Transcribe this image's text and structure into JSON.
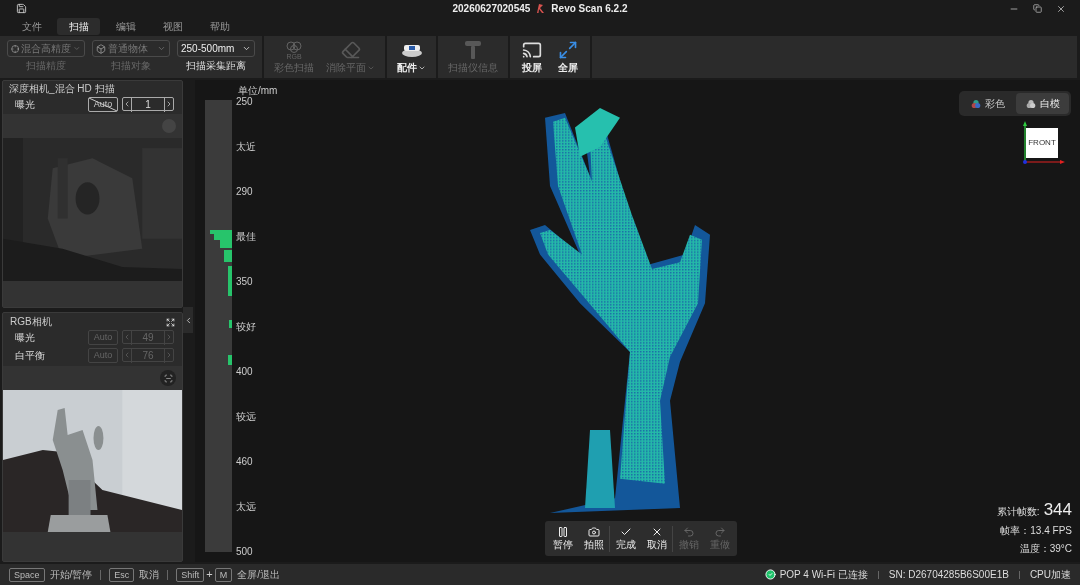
{
  "title_bar": {
    "title": "20260627020545",
    "app_name": "Revo Scan 6.2.2"
  },
  "menu_tabs": [
    {
      "label": "文件",
      "selected": false
    },
    {
      "label": "扫描",
      "selected": true
    },
    {
      "label": "编辑",
      "selected": false
    },
    {
      "label": "视图",
      "selected": false
    },
    {
      "label": "帮助",
      "selected": false
    }
  ],
  "toolbar": {
    "dropdowns": [
      {
        "value": "混合高精度",
        "caption": "扫描精度",
        "disabled": true
      },
      {
        "value": "普通物体",
        "caption": "扫描对象",
        "disabled": true
      },
      {
        "value": "250-500mm",
        "caption": "扫描采集距离",
        "disabled": false
      }
    ],
    "groups": [
      [
        {
          "label": "彩色扫描",
          "icon_text": "RGB",
          "disabled": true,
          "has_menu": false
        },
        {
          "label": "消除平面",
          "disabled": true,
          "has_menu": true
        }
      ],
      [
        {
          "label": "配件",
          "disabled": false,
          "has_menu": true
        }
      ],
      [
        {
          "label": "扫描仪信息",
          "disabled": true,
          "has_menu": false
        }
      ],
      [
        {
          "label": "投屏",
          "disabled": false,
          "has_menu": false
        },
        {
          "label": "全屏",
          "disabled": false,
          "has_menu": false
        }
      ]
    ]
  },
  "depth_camera": {
    "title": "深度相机_混合 HD 扫描",
    "controls": [
      {
        "label": "曝光",
        "auto_label": "Auto",
        "auto_on": false,
        "value": "1",
        "disabled": false
      }
    ]
  },
  "rgb_camera": {
    "title": "RGB相机",
    "controls": [
      {
        "label": "曝光",
        "auto_label": "Auto",
        "auto_on": true,
        "value": "49",
        "disabled": true
      },
      {
        "label": "白平衡",
        "auto_label": "Auto",
        "auto_on": true,
        "value": "76",
        "disabled": true
      }
    ]
  },
  "ruler": {
    "unit": "单位/mm",
    "labels": [
      "250",
      "太近",
      "290",
      "最佳",
      "350",
      "较好",
      "400",
      "较远",
      "460",
      "太远",
      "500"
    ]
  },
  "view_modes": [
    {
      "label": "彩色",
      "selected": false
    },
    {
      "label": "白模",
      "selected": true
    }
  ],
  "axis_gizmo": {
    "label": "FRONT"
  },
  "stats": {
    "frame_count_label": "累计帧数:",
    "frame_count": "344",
    "fps": "帧率：13.4 FPS",
    "temperature": "温度：39°C"
  },
  "scan_controls": [
    {
      "label": "暂停",
      "disabled": false
    },
    {
      "label": "拍照",
      "disabled": false
    },
    {
      "label": "完成",
      "disabled": false
    },
    {
      "label": "取消",
      "disabled": false
    },
    {
      "label": "撤销",
      "disabled": true
    },
    {
      "label": "重做",
      "disabled": true
    }
  ],
  "shortcuts": [
    {
      "keys": [
        "Space"
      ],
      "action": "开始/暂停"
    },
    {
      "keys": [
        "Esc"
      ],
      "action": "取消"
    },
    {
      "keys": [
        "Shift",
        "M"
      ],
      "joiner": "+",
      "action": "全屏/退出"
    }
  ],
  "status": {
    "connection": "POP 4 Wi-Fi 已连接",
    "connected": true,
    "serial": "SN: D26704285B6S00E1B",
    "mode": "CPU加速"
  }
}
